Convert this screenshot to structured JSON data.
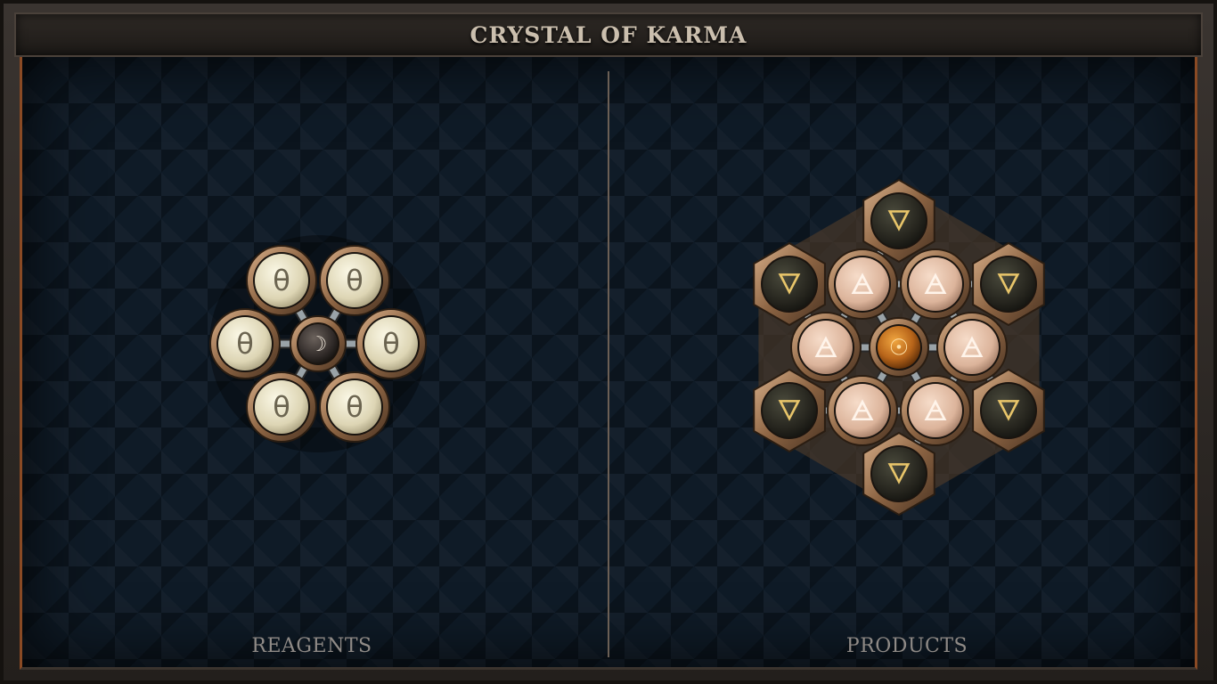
{
  "title": "CRYSTAL OF KARMA",
  "reagents": {
    "label": "REAGENTS",
    "center": {
      "glyph": "☽",
      "icon": "moon-icon"
    },
    "outer": [
      {
        "glyph": "θ",
        "icon": "theta-rune-icon"
      },
      {
        "glyph": "θ",
        "icon": "theta-rune-icon"
      },
      {
        "glyph": "θ",
        "icon": "theta-rune-icon"
      },
      {
        "glyph": "θ",
        "icon": "theta-rune-icon"
      },
      {
        "glyph": "θ",
        "icon": "theta-rune-icon"
      },
      {
        "glyph": "θ",
        "icon": "theta-rune-icon"
      }
    ]
  },
  "products": {
    "label": "PRODUCTS",
    "center": {
      "glyph": "☉",
      "icon": "sun-icon"
    },
    "inner": [
      {
        "glyph": "🜁",
        "icon": "air-rune-icon"
      },
      {
        "glyph": "🜁",
        "icon": "air-rune-icon"
      },
      {
        "glyph": "🜁",
        "icon": "air-rune-icon"
      },
      {
        "glyph": "🜁",
        "icon": "air-rune-icon"
      },
      {
        "glyph": "🜁",
        "icon": "air-rune-icon"
      },
      {
        "glyph": "🜁",
        "icon": "air-rune-icon"
      }
    ],
    "outer": [
      {
        "glyph": "🜄",
        "icon": "earth-rune-icon"
      },
      {
        "glyph": "🜄",
        "icon": "earth-rune-icon"
      },
      {
        "glyph": "🜄",
        "icon": "earth-rune-icon"
      },
      {
        "glyph": "🜄",
        "icon": "earth-rune-icon"
      },
      {
        "glyph": "🜄",
        "icon": "earth-rune-icon"
      },
      {
        "glyph": "🜄",
        "icon": "earth-rune-icon"
      }
    ]
  },
  "colors": {
    "accent_copper": "#8a4a24",
    "bronze": "#a47a55",
    "pearl": "#e8e2c6",
    "blush": "#e6c2aa",
    "dark_orb": "#2a2a22",
    "sun_orb": "#c8741c",
    "gold_glyph": "#e8c56a"
  }
}
